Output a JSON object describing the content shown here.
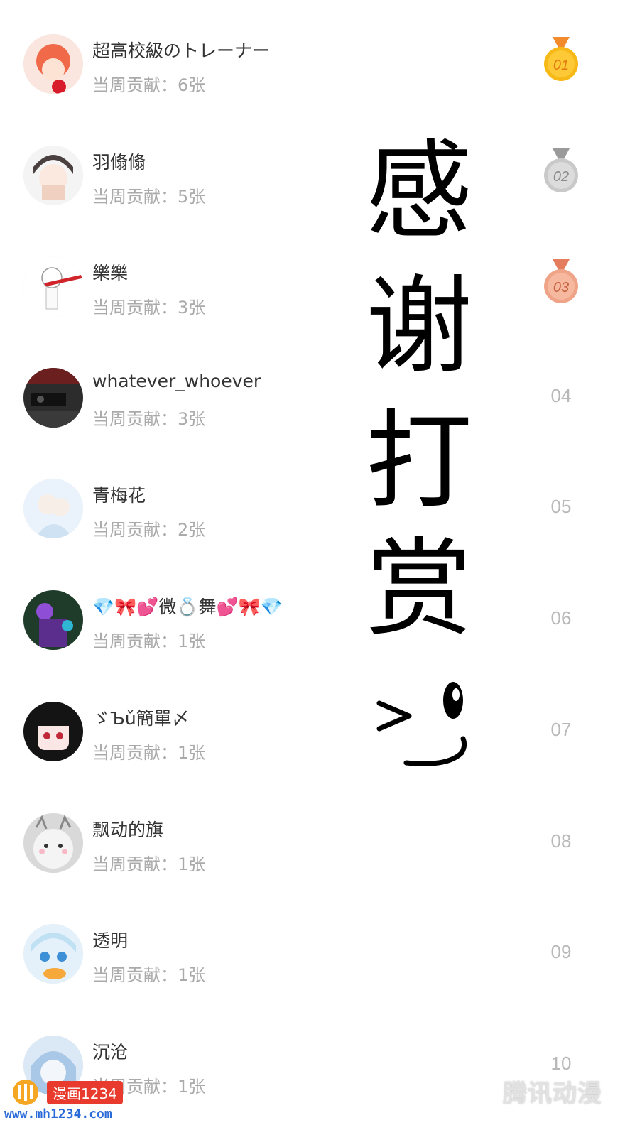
{
  "ranking": [
    {
      "rank": "01",
      "name": "超高校級のトレーナー",
      "contribution": "当周贡献：6张",
      "medal": "gold"
    },
    {
      "rank": "02",
      "name": "羽翛翛",
      "contribution": "当周贡献：5张",
      "medal": "silver"
    },
    {
      "rank": "03",
      "name": "樂樂",
      "contribution": "当周贡献：3张",
      "medal": "bronze"
    },
    {
      "rank": "04",
      "name": "whatever_whoever",
      "contribution": "当周贡献：3张"
    },
    {
      "rank": "05",
      "name": "青梅花",
      "contribution": "当周贡献：2张"
    },
    {
      "rank": "06",
      "name": "💎🎀💕微💍舞💕🎀💎",
      "contribution": "当周贡献：1张"
    },
    {
      "rank": "07",
      "name": "ゞЪǔ簡單〆",
      "contribution": "当周贡献：1张"
    },
    {
      "rank": "08",
      "name": "飘动的旗",
      "contribution": "当周贡献：1张"
    },
    {
      "rank": "09",
      "name": "透明",
      "contribution": "当周贡献：1张"
    },
    {
      "rank": "10",
      "name": "沉沧",
      "contribution": "当周贡献：1张"
    }
  ],
  "thanks_text": [
    "感",
    "谢",
    "打",
    "赏"
  ],
  "logo": {
    "label": "漫画1234",
    "url": "www.mh1234.com"
  },
  "watermark": "腾讯动漫",
  "colors": {
    "gold": "#f7b917",
    "silver": "#c9c9c9",
    "bronze": "#f0a487",
    "rank_text": "#b8b8b8",
    "name_text": "#333333",
    "contrib_text": "#aaaaaa"
  }
}
